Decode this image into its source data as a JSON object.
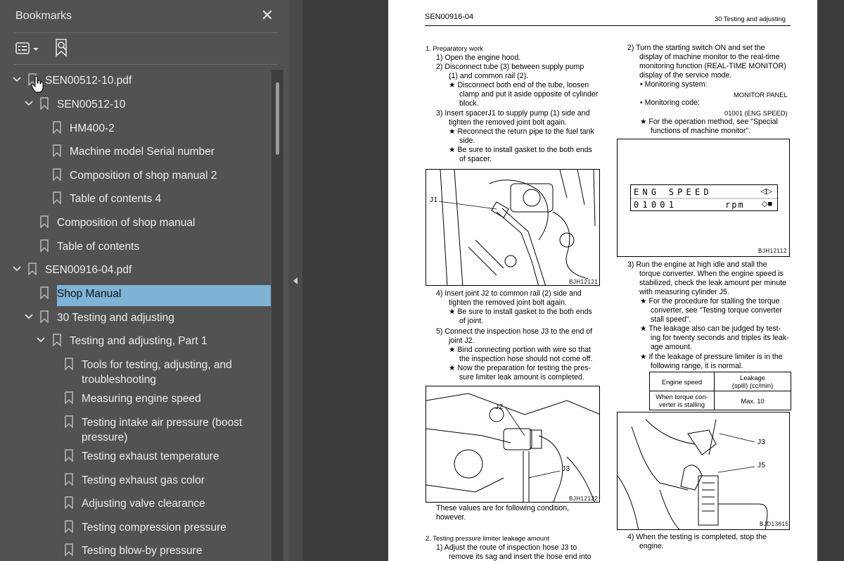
{
  "sidebar": {
    "title": "Bookmarks",
    "close_glyph": "✕",
    "tree": [
      {
        "label": "SEN00512-10.pdf",
        "expanded": true,
        "selected": false
      },
      {
        "label": "SEN00512-10",
        "expanded": true,
        "selected": false
      },
      {
        "label": "HM400-2",
        "selected": false
      },
      {
        "label": "Machine model Serial number",
        "selected": false
      },
      {
        "label": "Composition of shop manual 2",
        "selected": false
      },
      {
        "label": "Table of contents 4",
        "selected": false
      },
      {
        "label": "Composition of shop manual",
        "selected": false
      },
      {
        "label": "Table of contents",
        "selected": false
      },
      {
        "label": "SEN00916-04.pdf",
        "expanded": true,
        "selected": false
      },
      {
        "label": "Shop Manual",
        "selected": true
      },
      {
        "label": "30 Testing and adjusting",
        "expanded": true,
        "selected": false
      },
      {
        "label": "Testing and adjusting, Part 1",
        "expanded": true,
        "selected": false
      },
      {
        "label": "Tools for testing, adjusting, and troubleshooting",
        "selected": false
      },
      {
        "label": "Measuring engine speed",
        "selected": false
      },
      {
        "label": "Testing intake air pressure (boost pressure)",
        "selected": false
      },
      {
        "label": "Testing exhaust temperature",
        "selected": false
      },
      {
        "label": "Testing exhaust gas color",
        "selected": false
      },
      {
        "label": "Adjusting valve clearance",
        "selected": false
      },
      {
        "label": "Testing compression pressure",
        "selected": false
      },
      {
        "label": "Testing blow-by pressure",
        "selected": false
      }
    ],
    "selection_color": "#7eb3d6"
  },
  "document": {
    "header_left": "SEN00916-04",
    "header_right": "30 Testing and adjusting",
    "left_col": {
      "s1": "1.  Preparatory work",
      "l1": "1)  Open the engine hood.",
      "l2a": "2)  Disconnect tube (3) between supply pump",
      "l2b": "(1) and common rail (2).",
      "l3a": "★  Disconnect both end of the tube, loosen",
      "l3b": "clamp and put it aside opposite of cylinder",
      "l3c": "block.",
      "l4a": "3)  Insert spacerJ1 to supply pump (1) side and",
      "l4b": "tighten the removed joint bolt again.",
      "l5a": "★  Reconnect the return pipe to the fuel tank",
      "l5b": "side.",
      "l6a": "★  Be sure to install gasket to the both ends",
      "l6b": "of spacer.",
      "fig1_label": "J1",
      "fig1_caption": "BJH12121",
      "l7a": "4)  Insert joint J2 to common rail (2) side and",
      "l7b": "tighten the removed joint bolt again.",
      "l8a": "★  Be sure to install gasket to the both ends",
      "l8b": "of joint.",
      "l9a": "5)  Connect the inspection hose J3 to the end of",
      "l9b": "joint J2.",
      "l10a": "★  Bind connecting portion with wire so that",
      "l10b": "the inspection hose should not come off.",
      "l11a": "★  Now the preparation for testing the pres-",
      "l11b": "sure limiter leak amount is completed.",
      "fig2_label_a": "J2",
      "fig2_label_b": "J3",
      "fig2_caption": "BJH12122",
      "l12a": "These  values  are  for  following  condition,",
      "l12b": "however.",
      "s2": "2.  Testing pressure limiter leakage amount",
      "l13a": "1)  Adjust the route of inspection hose J3 to",
      "l13b": "remove its sag and insert the hose end into"
    },
    "right_col": {
      "r1a": "2)  Turn  the  starting  switch  ON  and  set  the",
      "r1b": "display of machine monitor to the real-time",
      "r1c": "monitoring function (REAL-TIME MONITOR)",
      "r1d": "display of the service mode.",
      "r2": "•  Monitoring system:",
      "r2v": "MONITOR PANEL",
      "r3": "•  Monitoring code:",
      "r3v": "01001 (ENG SPEED)",
      "r4a": "★  For the operation method, see \"Special",
      "r4b": "functions of machine monitor\".",
      "lcd_top": "ENG SPEED",
      "lcd_bottom": "01001",
      "lcd_unit": "rpm",
      "fig3_caption": "BJH12112",
      "r5a": "3)  Run the engine at high idle and stall the",
      "r5b": "torque converter. When the engine speed is",
      "r5c": "stabilized, check the leak amount per minute",
      "r5d": "with measuring cylinder J5.",
      "r6a": "★  For the procedure for stalling the torque",
      "r6b": "converter, see \"Testing torque converter",
      "r6c": "stall speed\".",
      "r7a": "★  The leakage also can be judged by test-",
      "r7b": "ing for twenty seconds and triples its leak-",
      "r7c": "age amount.",
      "r8a": "★  If the leakage of pressure limiter is in the",
      "r8b": "following range, it is normal.",
      "table": {
        "h1": "Engine speed",
        "h2a": "Leakage",
        "h2b": "(spill) (cc/min)",
        "c1a": "When torque  con-",
        "c1b": "verter is stalling",
        "c2": "Max. 10"
      },
      "fig4_label_a": "J3",
      "fig4_label_b": "J5",
      "fig4_caption": "BJD13615",
      "r9a": "4)  When  the  testing  is  completed,  stop  the",
      "r9b": "engine."
    }
  }
}
